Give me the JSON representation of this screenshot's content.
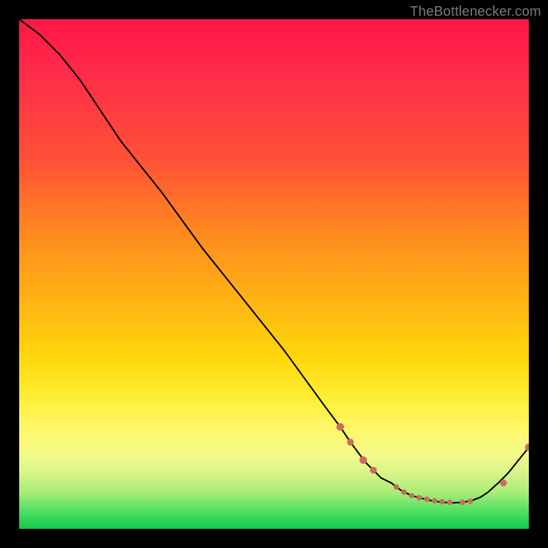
{
  "watermark_text": "TheBottlenecker.com",
  "chart_data": {
    "type": "line",
    "title": "",
    "xlabel": "",
    "ylabel": "",
    "xlim": [
      0,
      100
    ],
    "ylim": [
      0,
      100
    ],
    "x": [
      0,
      4,
      8,
      12,
      16,
      20,
      28,
      36,
      44,
      52,
      60,
      63,
      65,
      68,
      71,
      73,
      75,
      77,
      79,
      81,
      83,
      85,
      87,
      89,
      90.5,
      92,
      94,
      96,
      98,
      100
    ],
    "values": [
      100,
      97,
      93,
      88,
      82,
      76,
      66,
      55,
      45,
      35,
      24,
      20,
      17,
      13,
      10,
      9,
      7.5,
      6.5,
      6,
      5.5,
      5.2,
      5.1,
      5.2,
      5.6,
      6.2,
      7.2,
      9,
      11,
      13.5,
      16
    ],
    "markers_x": [
      63,
      65,
      67.5,
      69.5,
      74,
      75.5,
      77,
      78.5,
      80,
      81.5,
      83,
      84.5,
      87,
      88.5,
      95,
      100
    ],
    "markers_y": [
      20,
      17,
      13.5,
      11.5,
      8.2,
      7.2,
      6.5,
      6.1,
      5.8,
      5.5,
      5.3,
      5.2,
      5.2,
      5.4,
      9,
      16
    ],
    "marker_radii": [
      5.5,
      5,
      5.5,
      5,
      4,
      4,
      4,
      4,
      4,
      4,
      4,
      4,
      4,
      4,
      5,
      5.5
    ],
    "gradient_colors": [
      "#ff1744",
      "#ff2a4a",
      "#ff5236",
      "#ff8a1f",
      "#ffb314",
      "#ffd60a",
      "#ffed33",
      "#fff766",
      "#f5fa88",
      "#d9f58a",
      "#a5ec76",
      "#45df60",
      "#12c94a"
    ]
  }
}
